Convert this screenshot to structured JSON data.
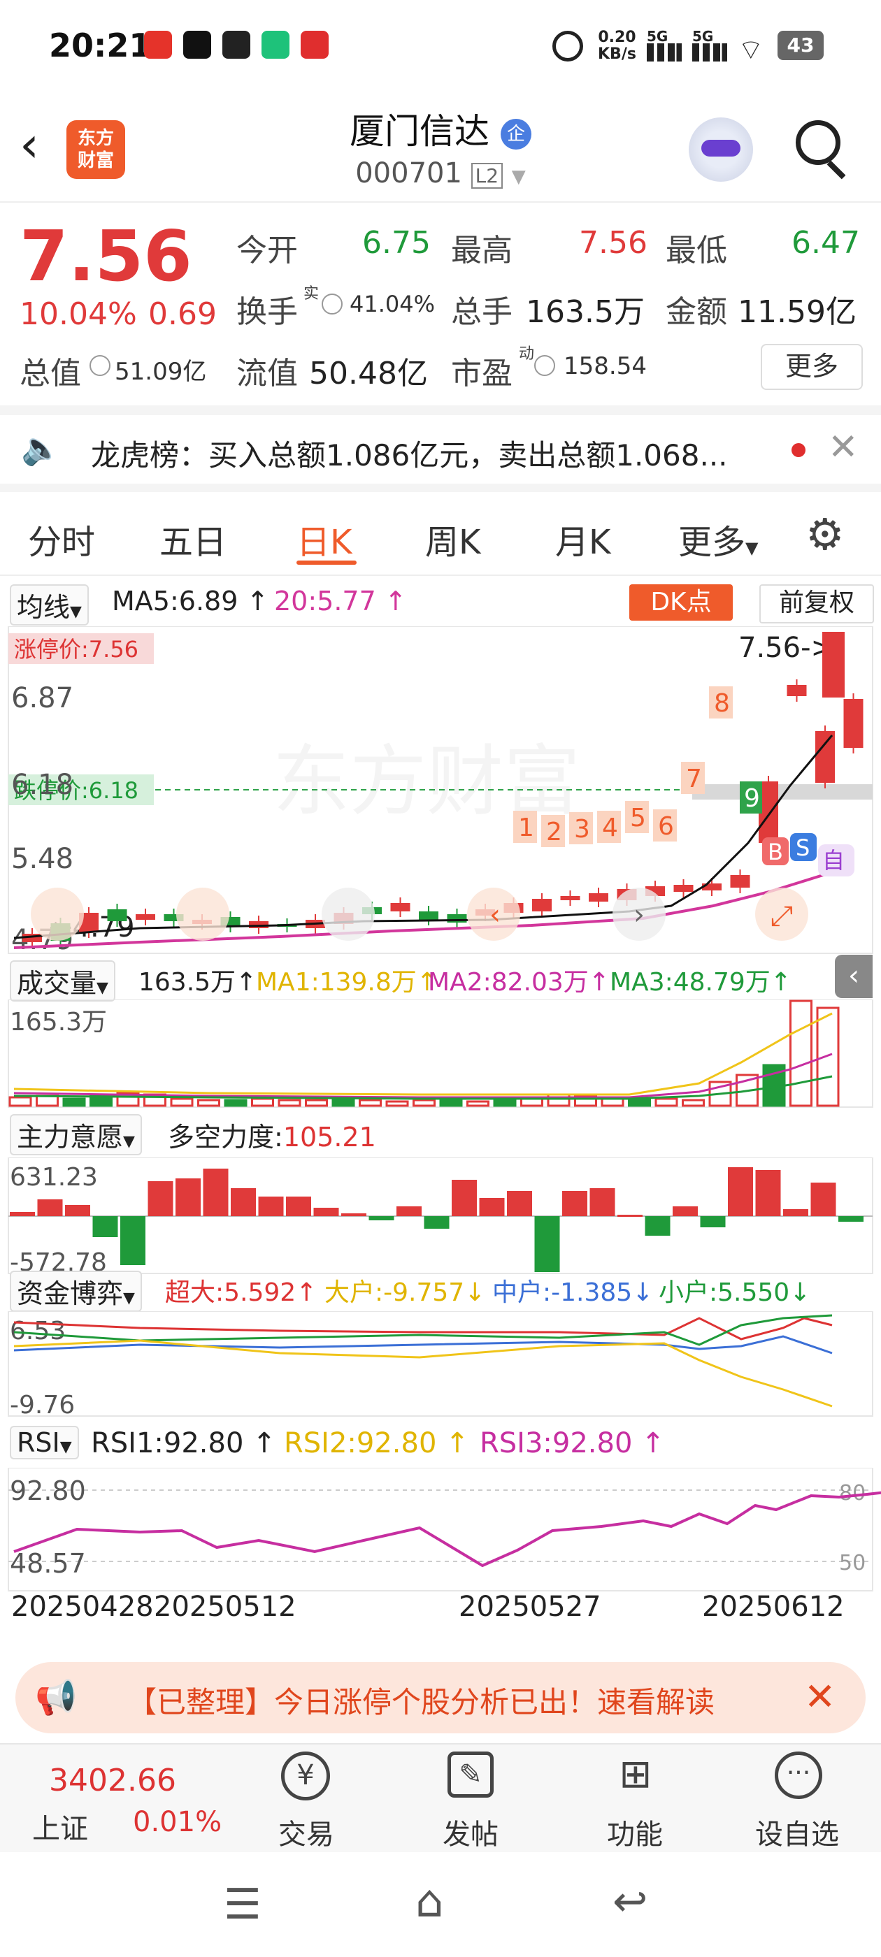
{
  "status": {
    "time": "20:21",
    "net_speed_top": "0.20",
    "net_speed_unit": "KB/s",
    "sig1": "5G",
    "sig2": "5G",
    "battery": "43"
  },
  "header": {
    "title": "厦门信达",
    "code": "000701",
    "l2": "L2",
    "logo_line1": "东方",
    "logo_line2": "财富",
    "badge": "企"
  },
  "quote": {
    "price": "7.56",
    "pct": "10.04%",
    "change": "0.69",
    "open_label": "今开",
    "open": "6.75",
    "high_label": "最高",
    "high": "7.56",
    "low_label": "最低",
    "low": "6.47",
    "turnover_label": "换手",
    "turnover_sup": "实",
    "turnover": "41.04%",
    "volume_label": "总手",
    "volume": "163.5万",
    "amount_label": "金额",
    "amount": "11.59亿",
    "mcap_label": "总值",
    "mcap": "51.09亿",
    "float_label": "流值",
    "float": "50.48亿",
    "pe_label": "市盈",
    "pe_sup": "动",
    "pe": "158.54",
    "more": "更多"
  },
  "notice": {
    "text": "龙虎榜：买入总额1.086亿元，卖出总额1.068..."
  },
  "tabs": [
    {
      "label": "分时"
    },
    {
      "label": "五日"
    },
    {
      "label": "日K",
      "active": true
    },
    {
      "label": "周K"
    },
    {
      "label": "月K"
    },
    {
      "label": "更多"
    }
  ],
  "kline": {
    "ma_dropdown": "均线",
    "ma5": "MA5:6.89",
    "ma20": "20:5.77",
    "dk": "DK点",
    "adjust": "前复权",
    "limit_up": "涨停价:7.56",
    "limit_down": "跌停价:6.18",
    "y1": "6.87",
    "y2": "6.18",
    "y3": "5.48",
    "y4": "4.79",
    "last_label": "7.56->",
    "low_label": "4.79",
    "nums": [
      "1",
      "2",
      "3",
      "4",
      "5",
      "6",
      "7",
      "8",
      "9"
    ],
    "watermark": "东方财富",
    "mark_b": "B",
    "mark_s": "S",
    "mark_zi": "自"
  },
  "volume": {
    "dropdown": "成交量",
    "value": "163.5万",
    "ma1": "MA1:139.8万",
    "ma2": "MA2:82.03万",
    "ma3": "MA3:48.79万",
    "ymax": "165.3万"
  },
  "force": {
    "dropdown": "主力意愿",
    "label": "多空力度:",
    "value": "105.21",
    "ymax": "631.23",
    "ymin": "-572.78"
  },
  "funds": {
    "dropdown": "资金博弈",
    "super": "超大:5.592",
    "big": "大户:-9.757",
    "mid": "中户:-1.385",
    "small": "小户:5.550",
    "ymax": "6.53",
    "ymin": "-9.76"
  },
  "rsi": {
    "dropdown": "RSI",
    "rsi1": "RSI1:92.80",
    "rsi2": "RSI2:92.80",
    "rsi3": "RSI3:92.80",
    "y1": "92.80",
    "y2": "48.57",
    "r80": "80",
    "r50": "50"
  },
  "dates": [
    "20250428",
    "20250512",
    "20250527",
    "20250612"
  ],
  "banner": {
    "text": "【已整理】今日涨停个股分析已出！速看解读"
  },
  "bottom_nav": {
    "index_value": "3402.66",
    "index_name": "上证",
    "index_pct": "0.01%",
    "trade": "交易",
    "post": "发帖",
    "func": "功能",
    "watch": "设自选"
  },
  "colors": {
    "up": "#e03a3a",
    "down": "#1f9a3a",
    "accent": "#ef5b2b",
    "ma20": "#d2369b",
    "ma_yellow": "#f0c419",
    "blue": "#3b6fd6"
  }
}
